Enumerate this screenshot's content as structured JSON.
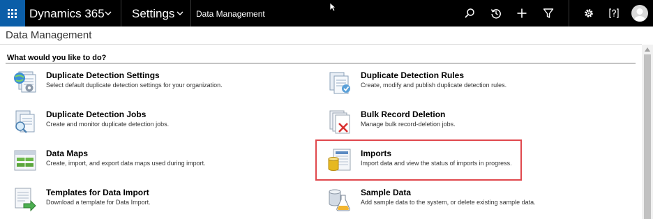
{
  "topbar": {
    "app_name": "Dynamics 365",
    "area": "Settings",
    "breadcrumb": "Data Management",
    "icons": [
      "app-launcher-icon",
      "search-icon",
      "recent-icon",
      "new-icon",
      "filter-icon",
      "settings-icon",
      "help-icon",
      "user-avatar-icon"
    ],
    "colors": {
      "bar": "#000000",
      "launcher": "#0b5ea8"
    }
  },
  "page": {
    "title": "Data Management",
    "section_heading": "What would you like to do?"
  },
  "items": [
    {
      "title": "Duplicate Detection Settings",
      "description": "Select default duplicate detection settings for your organization.",
      "icon": "duplicate-detection-settings-icon"
    },
    {
      "title": "Duplicate Detection Rules",
      "description": "Create, modify and publish duplicate detection rules.",
      "icon": "duplicate-detection-rules-icon"
    },
    {
      "title": "Duplicate Detection Jobs",
      "description": "Create and monitor duplicate detection jobs.",
      "icon": "duplicate-detection-jobs-icon"
    },
    {
      "title": "Bulk Record Deletion",
      "description": "Manage bulk record-deletion jobs.",
      "icon": "bulk-record-deletion-icon"
    },
    {
      "title": "Data Maps",
      "description": "Create, import, and export data maps used during import.",
      "icon": "data-maps-icon"
    },
    {
      "title": "Imports",
      "description": "Import data and view the status of imports in progress.",
      "icon": "imports-icon",
      "highlighted": true
    },
    {
      "title": "Templates for Data Import",
      "description": "Download a template for Data Import.",
      "icon": "templates-icon"
    },
    {
      "title": "Sample Data",
      "description": "Add sample data to the system, or delete existing sample data.",
      "icon": "sample-data-icon"
    }
  ],
  "highlight_color": "#e0484d"
}
